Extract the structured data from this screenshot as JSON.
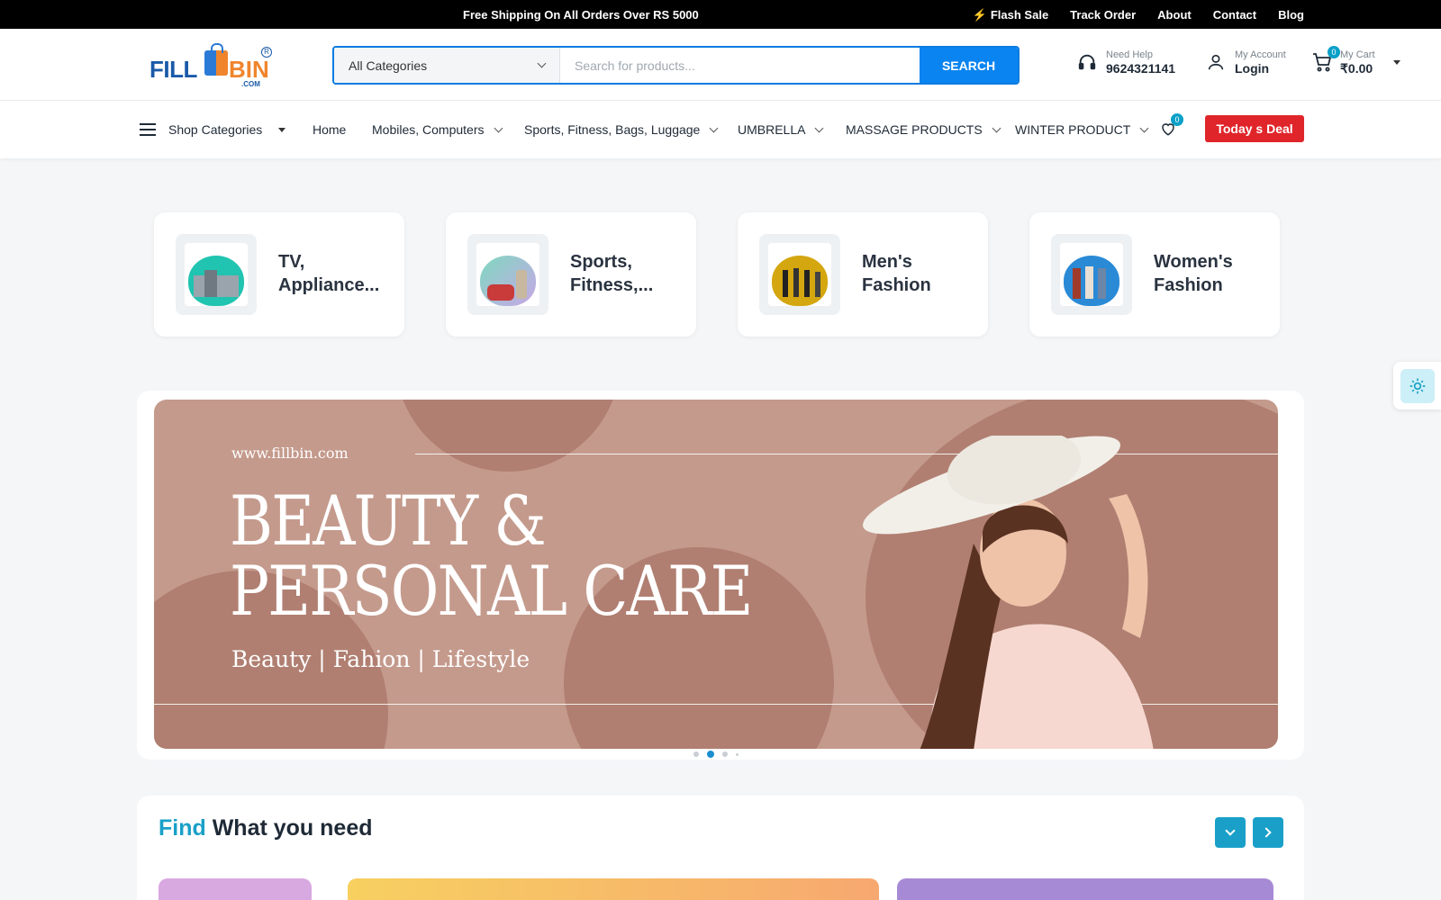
{
  "topbar": {
    "shipping": "Free Shipping On All Orders Over RS 5000",
    "links": [
      "Flash Sale",
      "Track Order",
      "About",
      "Contact",
      "Blog"
    ]
  },
  "logo": {
    "part1": "FILL",
    "part2": "BIN",
    "sub": ".COM",
    "reg": "R"
  },
  "search": {
    "category": "All Categories",
    "placeholder": "Search for products...",
    "value": "",
    "button": "SEARCH"
  },
  "help": {
    "label": "Need Help",
    "phone": "9624321141"
  },
  "account": {
    "label": "My Account",
    "action": "Login"
  },
  "cart": {
    "label": "My Cart",
    "total": "₹0.00",
    "count": "0"
  },
  "nav": {
    "shop_categories": "Shop Categories",
    "items": [
      {
        "label": "Home"
      },
      {
        "label": "Mobiles, Computers"
      },
      {
        "label": "Sports, Fitness, Bags, Luggage"
      },
      {
        "label": "UMBRELLA"
      },
      {
        "label": "MASSAGE PRODUCTS"
      },
      {
        "label": "WINTER PRODUCT"
      }
    ],
    "wishlist_count": "0",
    "deal": "Today s Deal"
  },
  "categories": [
    {
      "label": "TV, Appliance..."
    },
    {
      "label": "Sports, Fitness,..."
    },
    {
      "label": "Men's Fashion"
    },
    {
      "label": "Women's Fashion"
    }
  ],
  "banner": {
    "site": "www.fillbin.com",
    "headline_1": "BEAUTY &",
    "headline_2": "PERSONAL CARE",
    "subtitle": "Beauty | Fahion | Lifestyle",
    "slide_count": 4,
    "active_slide": 2
  },
  "find": {
    "title_highlight": "Find",
    "title_rest": " What you need"
  },
  "colors": {
    "accent": "#0a84f0",
    "teal": "#1aa0c8",
    "deal": "#e0252a",
    "banner": "#c49a8c"
  }
}
